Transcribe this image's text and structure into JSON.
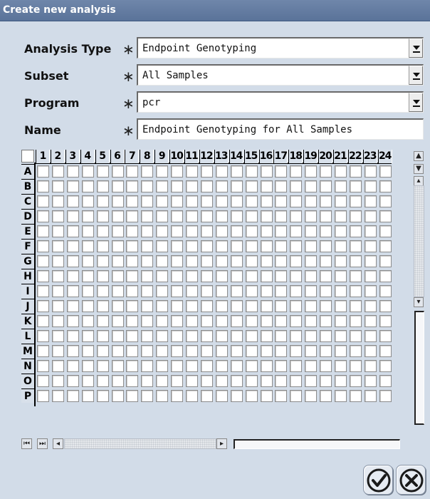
{
  "dialog": {
    "title": "Create new analysis"
  },
  "form": {
    "required_marker": "∗",
    "analysis_type": {
      "label": "Analysis Type",
      "value": "Endpoint Genotyping"
    },
    "subset": {
      "label": "Subset",
      "value": "All Samples"
    },
    "program": {
      "label": "Program",
      "value": "pcr"
    },
    "name": {
      "label": "Name",
      "value": "Endpoint Genotyping for All Samples"
    }
  },
  "plate": {
    "columns": [
      "1",
      "2",
      "3",
      "4",
      "5",
      "6",
      "7",
      "8",
      "9",
      "10",
      "11",
      "12",
      "13",
      "14",
      "15",
      "16",
      "17",
      "18",
      "19",
      "20",
      "21",
      "22",
      "23",
      "24"
    ],
    "rows": [
      "A",
      "B",
      "C",
      "D",
      "E",
      "F",
      "G",
      "H",
      "I",
      "J",
      "K",
      "L",
      "M",
      "N",
      "O",
      "P"
    ]
  },
  "icons": {
    "scroll_first": "scroll-top-icon",
    "scroll_prev_page": "scroll-page-down-icon",
    "scroll_up": "scroll-up-arrow-icon",
    "scroll_down": "scroll-down-arrow-icon",
    "h_first": "skip-first-icon",
    "h_last": "skip-last-icon",
    "h_left": "scroll-left-arrow-icon",
    "h_right": "scroll-right-arrow-icon",
    "ok": "check-circle-icon",
    "cancel": "x-circle-icon"
  },
  "colors": {
    "title_bar": "#5f789e",
    "background": "#d2dce8",
    "field_bg": "#ffffff"
  }
}
